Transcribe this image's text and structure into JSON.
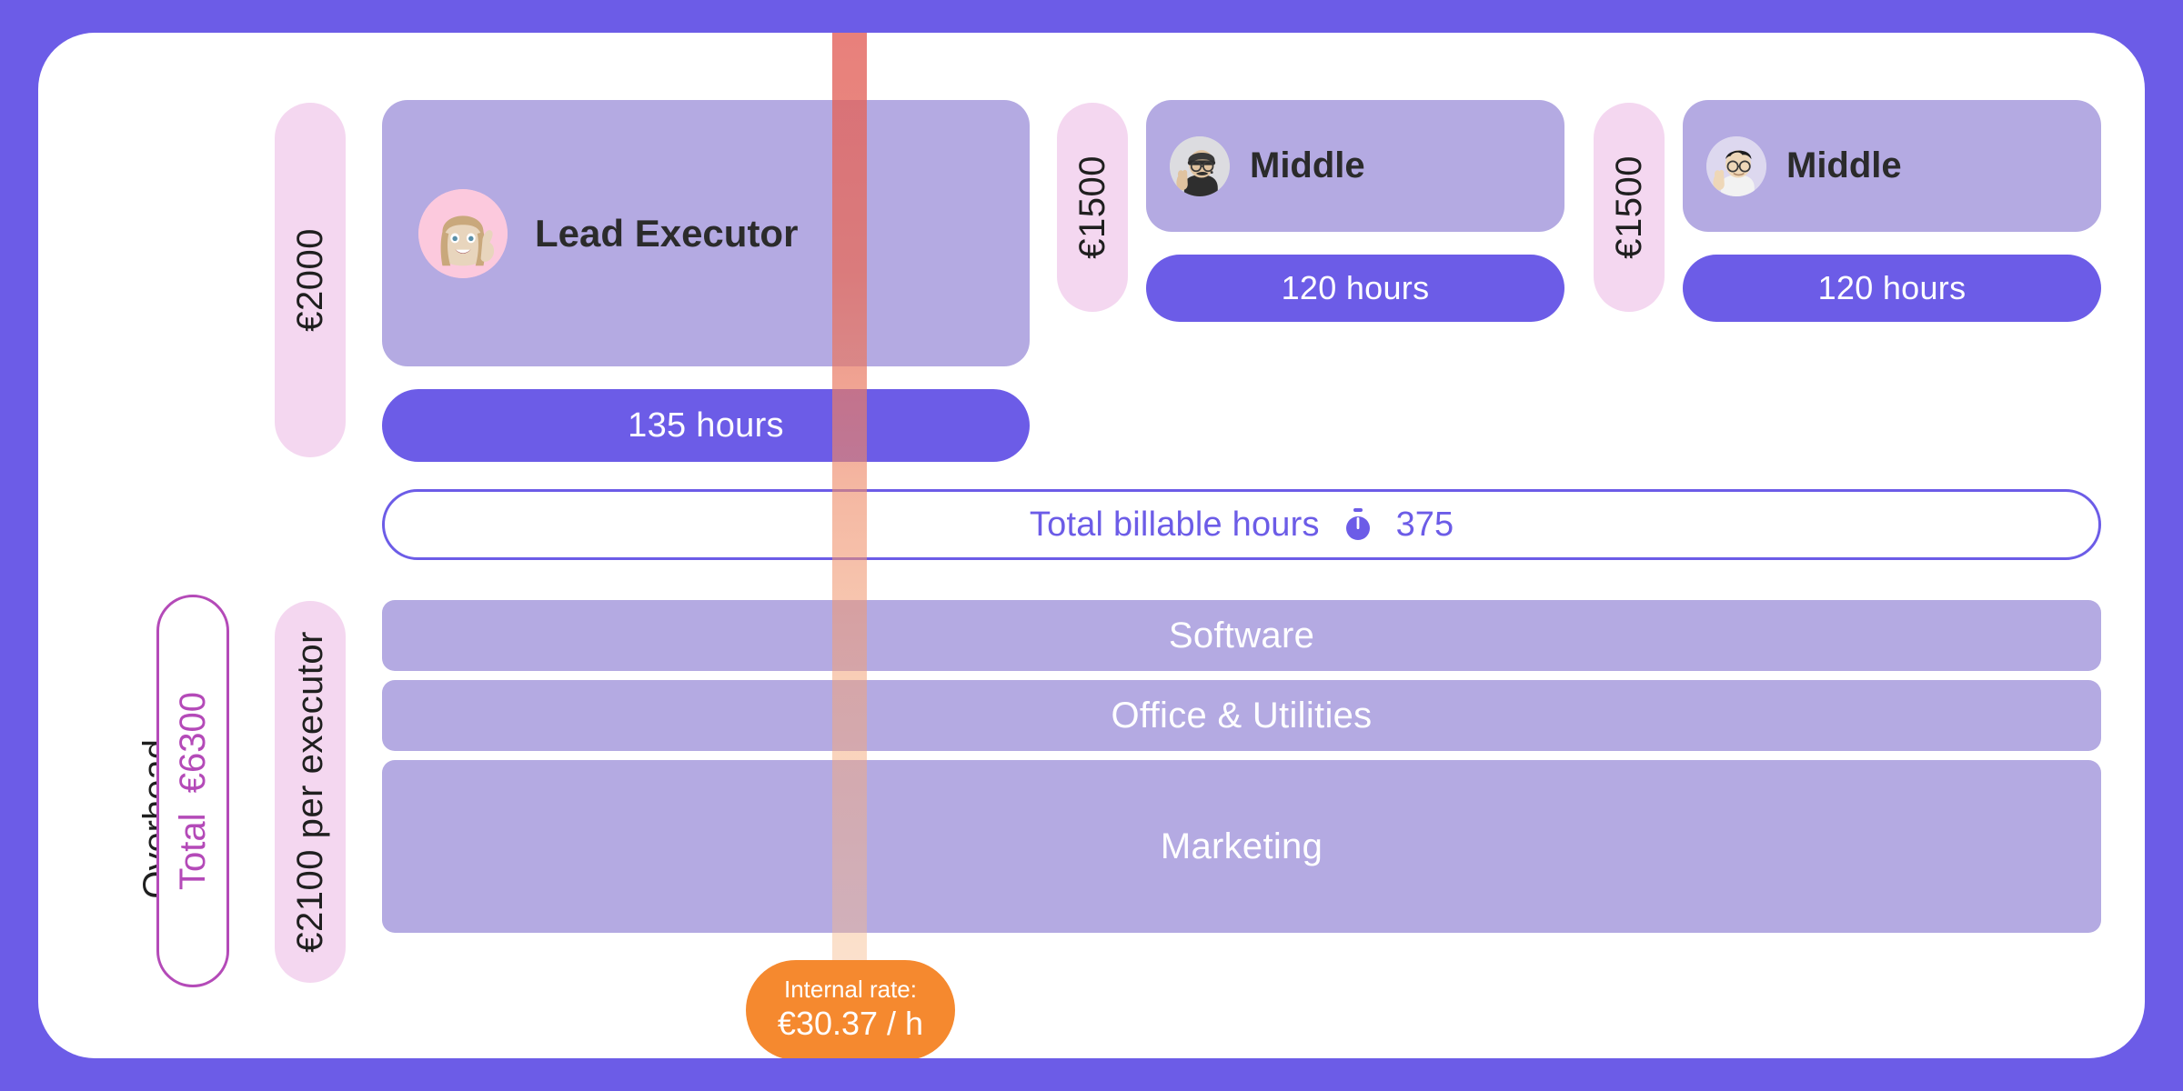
{
  "theme": {
    "page_background": "#6c5ce7",
    "card_background": "#ffffff",
    "accent_purple": "#6c5ce7",
    "muted_purple": "#b4aae2",
    "pink_pill": "#f4d7f0",
    "magenta_outline": "#b44ab8",
    "orange_badge": "#f5892f",
    "rate_column_top": "#e2605a",
    "rate_column_bottom": "#f6be8e"
  },
  "executors": [
    {
      "cost_label": "€2000",
      "role": "Lead Executor",
      "hours_label": "135 hours",
      "avatar_name": "woman-raising-finger-avatar",
      "avatar_bg": "#fcc9dd"
    },
    {
      "cost_label": "€1500",
      "role": "Middle",
      "hours_label": "120 hours",
      "avatar_name": "man-thumbs-up-beanie-avatar",
      "avatar_bg": "#dcdce0"
    },
    {
      "cost_label": "€1500",
      "role": "Middle",
      "hours_label": "120 hours",
      "avatar_name": "man-thumbs-up-glasses-avatar",
      "avatar_bg": "#ddd8ef"
    }
  ],
  "billable": {
    "label": "Total billable hours",
    "value": "375",
    "icon": "stopwatch-icon"
  },
  "overhead": {
    "section_label": "Overhead",
    "total_label": "Total",
    "total_value": "€6300",
    "per_executor_label": "€2100 per executor",
    "rows": [
      {
        "label": "Software"
      },
      {
        "label": "Office & Utilities"
      },
      {
        "label": "Marketing"
      }
    ]
  },
  "internal_rate": {
    "title": "Internal rate:",
    "value": "€30.37 / h"
  }
}
